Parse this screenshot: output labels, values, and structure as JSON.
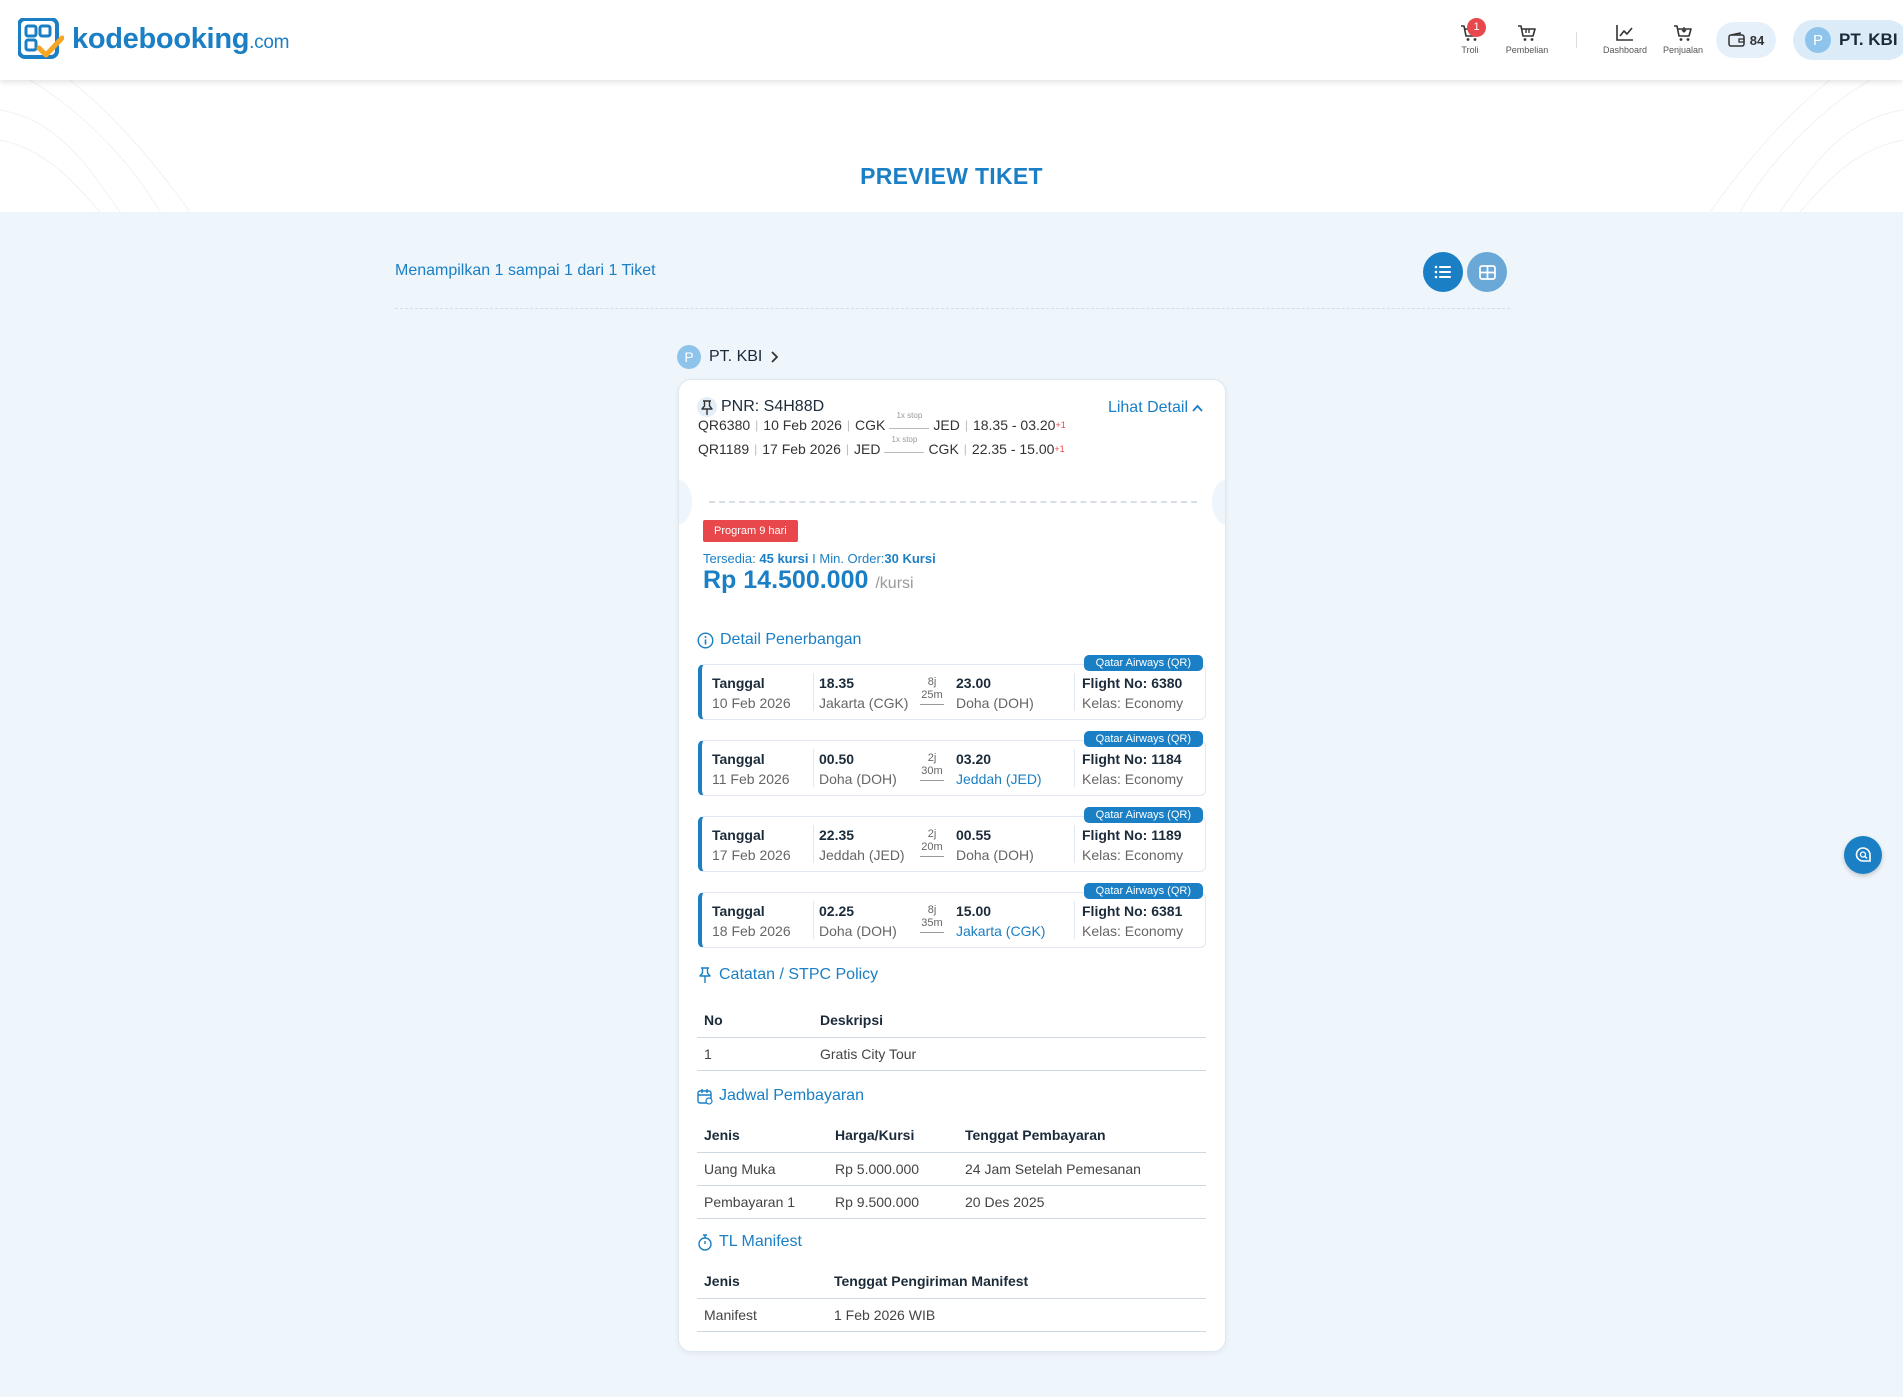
{
  "brand": {
    "name": "kodebooking",
    "tld": ".com"
  },
  "nav": {
    "cart_label": "Troli",
    "cart_count": "1",
    "purchase_label": "Pembelian",
    "dashboard_label": "Dashboard",
    "sales_label": "Penjualan",
    "wallet_value": "84",
    "user_initial": "P",
    "user_name": "PT. KBI"
  },
  "page": {
    "title": "PREVIEW TIKET",
    "showing": "Menampilkan 1 sampai 1 dari 1 Tiket"
  },
  "company": {
    "initial": "P",
    "name": "PT. KBI"
  },
  "ticket": {
    "pnr": "PNR: S4H88D",
    "detail_link": "Lihat Detail",
    "routes": [
      {
        "flight": "QR6380",
        "date": "10 Feb 2026",
        "from": "CGK",
        "stop": "1x stop",
        "to": "JED",
        "time": "18.35 - 03.20",
        "plus": "+1"
      },
      {
        "flight": "QR1189",
        "date": "17 Feb 2026",
        "from": "JED",
        "stop": "1x stop",
        "to": "CGK",
        "time": "22.35 - 15.00",
        "plus": "+1"
      }
    ],
    "program": "Program 9 hari",
    "avail_label": "Tersedia: ",
    "avail_value": "45 kursi",
    "min_label": " I Min. Order:",
    "min_value": "30 Kursi",
    "price": "Rp 14.500.000",
    "price_unit": "/kursi"
  },
  "flight_detail": {
    "title": "Detail Penerbangan",
    "date_label": "Tanggal",
    "segments": [
      {
        "date": "10 Feb 2026",
        "dep_time": "18.35",
        "dep_city": "Jakarta (CGK)",
        "dur_h": "8j",
        "dur_m": "25m",
        "arr_time": "23.00",
        "arr_city": "Doha (DOH)",
        "flight_no": "Flight No: 6380",
        "class": "Kelas: Economy",
        "airline": "Qatar Airways (QR)"
      },
      {
        "date": "11 Feb 2026",
        "dep_time": "00.50",
        "dep_city": "Doha (DOH)",
        "dur_h": "2j",
        "dur_m": "30m",
        "arr_time": "03.20",
        "arr_city": "Jeddah (JED)",
        "flight_no": "Flight No: 1184",
        "class": "Kelas: Economy",
        "airline": "Qatar Airways (QR)"
      },
      {
        "date": "17 Feb 2026",
        "dep_time": "22.35",
        "dep_city": "Jeddah (JED)",
        "dur_h": "2j",
        "dur_m": "20m",
        "arr_time": "00.55",
        "arr_city": "Doha (DOH)",
        "flight_no": "Flight No: 1189",
        "class": "Kelas: Economy",
        "airline": "Qatar Airways (QR)"
      },
      {
        "date": "18 Feb 2026",
        "dep_time": "02.25",
        "dep_city": "Doha (DOH)",
        "dur_h": "8j",
        "dur_m": "35m",
        "arr_time": "15.00",
        "arr_city": "Jakarta (CGK)",
        "flight_no": "Flight No: 6381",
        "class": "Kelas: Economy",
        "airline": "Qatar Airways (QR)"
      }
    ]
  },
  "policy": {
    "title": "Catatan / STPC Policy",
    "headers": [
      "No",
      "Deskripsi"
    ],
    "rows": [
      [
        "1",
        "Gratis City Tour"
      ]
    ]
  },
  "payment": {
    "title": "Jadwal Pembayaran",
    "headers": [
      "Jenis",
      "Harga/Kursi",
      "Tenggat Pembayaran"
    ],
    "rows": [
      [
        "Uang Muka",
        "Rp 5.000.000",
        "24 Jam Setelah Pemesanan"
      ],
      [
        "Pembayaran 1",
        "Rp 9.500.000",
        "20 Des 2025"
      ]
    ]
  },
  "manifest": {
    "title": "TL Manifest",
    "headers": [
      "Jenis",
      "Tenggat Pengiriman Manifest"
    ],
    "rows": [
      [
        "Manifest",
        "1 Feb 2026 WIB"
      ]
    ]
  },
  "colors": {
    "primary": "#1a7fc4",
    "danger": "#e8474b",
    "background": "#eef5fb"
  }
}
